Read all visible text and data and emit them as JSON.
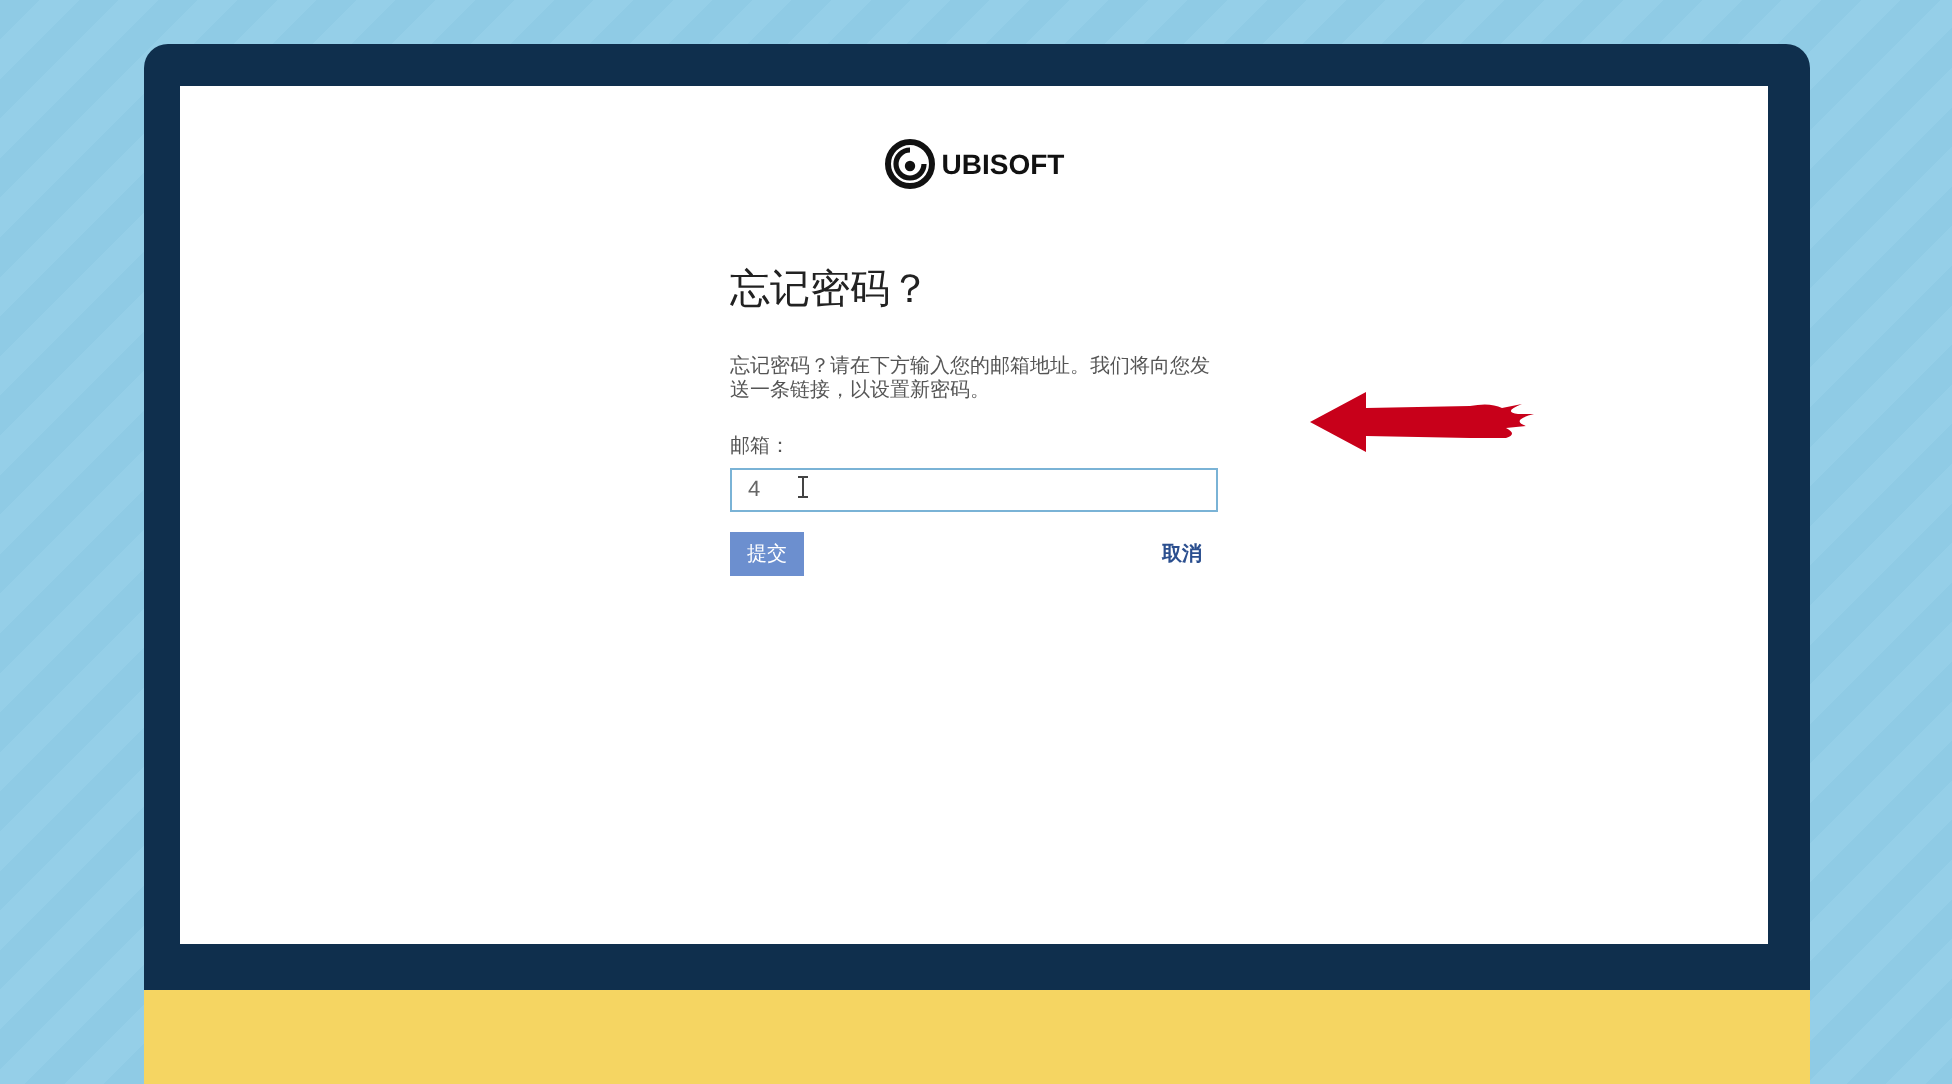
{
  "logo": {
    "text": "UBISOFT"
  },
  "heading": "忘记密码？",
  "description": "忘记密码？请在下方输入您的邮箱地址。我们将向您发送一条链接，以设置新密码。",
  "email": {
    "label": "邮箱：",
    "value": "4"
  },
  "buttons": [
    {
      "kind": "submit",
      "label": "提交"
    },
    {
      "kind": "cancel",
      "label": "取消"
    }
  ]
}
